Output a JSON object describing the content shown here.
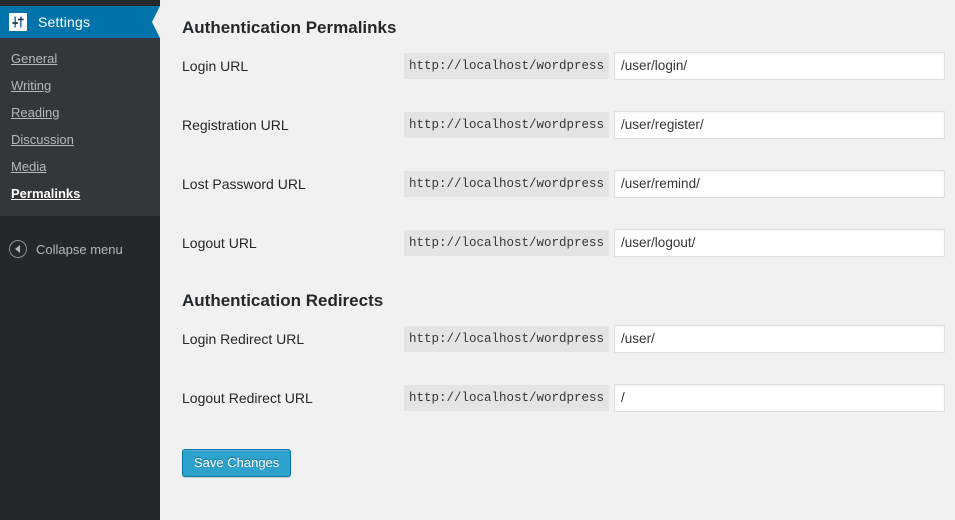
{
  "sidebar": {
    "menu_top": {
      "label": "Settings",
      "icon": "settings-sliders-icon"
    },
    "items": [
      {
        "label": "General",
        "current": false
      },
      {
        "label": "Writing",
        "current": false
      },
      {
        "label": "Reading",
        "current": false
      },
      {
        "label": "Discussion",
        "current": false
      },
      {
        "label": "Media",
        "current": false
      },
      {
        "label": "Permalinks",
        "current": true
      }
    ],
    "collapse": {
      "label": "Collapse menu",
      "icon": "collapse-arrow-left-icon"
    },
    "colors": {
      "background": "#23282d",
      "submenu_background": "#32373c",
      "highlight": "#0073aa",
      "item_text": "#b4b9be",
      "current_text": "#ffffff"
    }
  },
  "main": {
    "sections": [
      {
        "title": "Authentication Permalinks",
        "rows": [
          {
            "label": "Login URL",
            "prefix": "http://localhost/wordpress",
            "value": "/user/login/"
          },
          {
            "label": "Registration URL",
            "prefix": "http://localhost/wordpress",
            "value": "/user/register/"
          },
          {
            "label": "Lost Password URL",
            "prefix": "http://localhost/wordpress",
            "value": "/user/remind/"
          },
          {
            "label": "Logout URL",
            "prefix": "http://localhost/wordpress",
            "value": "/user/logout/"
          }
        ]
      },
      {
        "title": "Authentication Redirects",
        "rows": [
          {
            "label": "Login Redirect URL",
            "prefix": "http://localhost/wordpress",
            "value": "/user/"
          },
          {
            "label": "Logout Redirect URL",
            "prefix": "http://localhost/wordpress",
            "value": "/"
          }
        ]
      }
    ],
    "submit": {
      "label": "Save Changes",
      "color": "#2ea2cc"
    }
  }
}
